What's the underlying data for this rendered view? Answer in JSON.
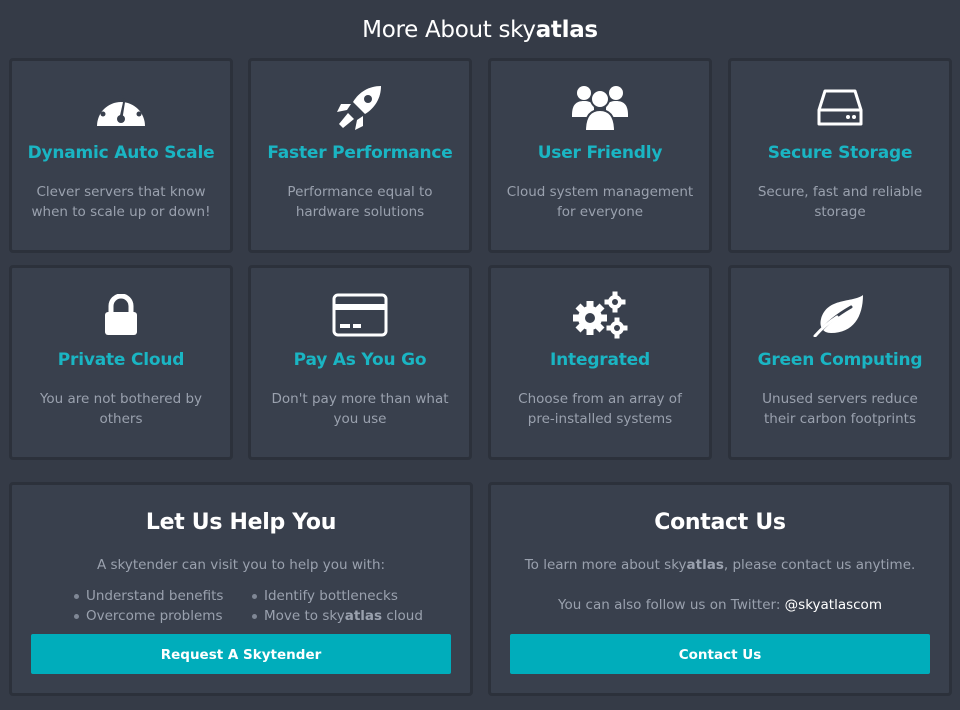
{
  "header": {
    "title_prefix": "More About sky",
    "title_brand": "atlas"
  },
  "features": [
    {
      "icon": "dashboard-icon",
      "title": "Dynamic Auto Scale",
      "desc": "Clever servers that know when to scale up or down!"
    },
    {
      "icon": "rocket-icon",
      "title": "Faster Performance",
      "desc": "Performance equal to hardware solutions"
    },
    {
      "icon": "users-icon",
      "title": "User Friendly",
      "desc": "Cloud system management for everyone"
    },
    {
      "icon": "hard-drive-icon",
      "title": "Secure Storage",
      "desc": "Secure, fast and reliable storage"
    },
    {
      "icon": "lock-icon",
      "title": "Private Cloud",
      "desc": "You are not bothered by others"
    },
    {
      "icon": "credit-card-icon",
      "title": "Pay As You Go",
      "desc": "Don't pay more than what you use"
    },
    {
      "icon": "gears-icon",
      "title": "Integrated",
      "desc": "Choose from an array of pre-installed systems"
    },
    {
      "icon": "leaf-icon",
      "title": "Green Computing",
      "desc": "Unused servers reduce their carbon footprints"
    }
  ],
  "help": {
    "title": "Let Us Help You",
    "intro": "A skytender can visit you to help you with:",
    "bullets": [
      {
        "text": "Understand benefits"
      },
      {
        "text": "Identify bottlenecks"
      },
      {
        "text": "Overcome problems"
      },
      {
        "prefix": "Move to sky",
        "brand": "atlas",
        "suffix": " cloud"
      }
    ],
    "button_label": "Request A Skytender"
  },
  "contact": {
    "title": "Contact Us",
    "line1_prefix": "To learn more about sky",
    "line1_brand": "atlas",
    "line1_suffix": ", please contact us anytime.",
    "line2_prefix": "You can also follow us on Twitter: ",
    "twitter_handle": "@skyatlascom",
    "button_label": "Contact Us"
  },
  "colors": {
    "background": "#353b47",
    "card": "#39404d",
    "accent": "#1ab5c3",
    "button": "#00adbb",
    "muted_text": "#9aa1ae"
  }
}
